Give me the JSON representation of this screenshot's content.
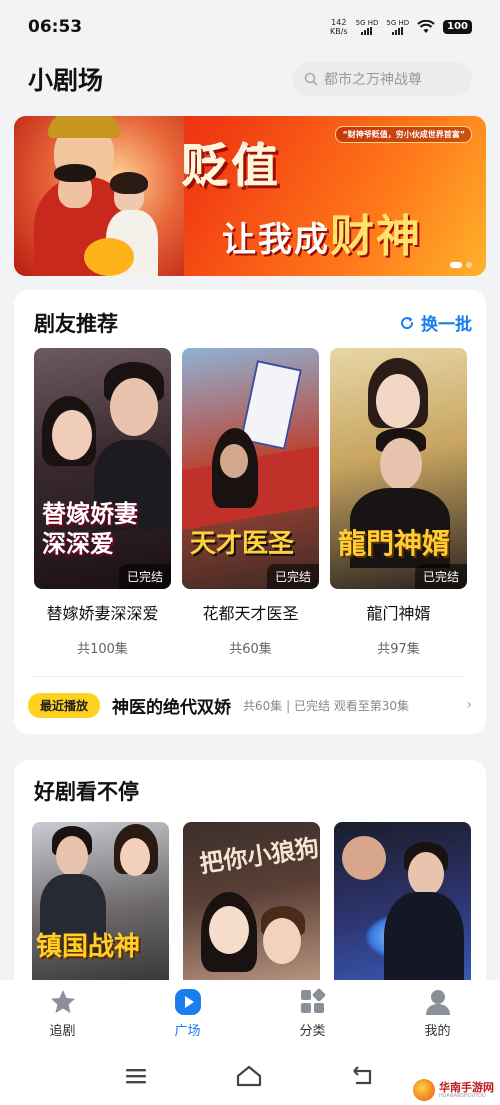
{
  "status_bar": {
    "time": "06:53",
    "net_speed_value": "142",
    "net_speed_unit": "KB/s",
    "sim1": "5G HD",
    "sim2": "5G HD",
    "battery": "100"
  },
  "header": {
    "title": "小剧场",
    "search_placeholder": "都市之万神战尊"
  },
  "banner": {
    "title_line1": "贬值",
    "title_line2_prefix": "让我成",
    "title_line2_big": "财神",
    "tagline": "“财神爷贬值，穷小伙成世界首富”",
    "accent_color": "#f23e12"
  },
  "recommend": {
    "title": "剧友推荐",
    "refresh_label": "换一批",
    "dramas": [
      {
        "name": "替嫁娇妻深深爱",
        "poster_text": "替嫁娇妻 深深爱",
        "status": "已完结",
        "episodes": "共100集"
      },
      {
        "name": "花都天才医圣",
        "poster_text": "天才医圣",
        "status": "已完结",
        "episodes": "共60集"
      },
      {
        "name": "龍门神婿",
        "poster_text": "龍門神婿",
        "status": "已完结",
        "episodes": "共97集"
      }
    ],
    "recent": {
      "badge": "最近播放",
      "title": "神医的绝代双娇",
      "info": "共60集 | 已完结 观看至第30集"
    }
  },
  "more": {
    "title": "好剧看不停",
    "posters": [
      {
        "poster_text": "镇国战神"
      },
      {
        "poster_text": "把你小狼狗"
      },
      {
        "poster_text": ""
      }
    ]
  },
  "bottom_nav": {
    "items": [
      {
        "label": "追剧",
        "icon": "star-icon"
      },
      {
        "label": "广场",
        "icon": "play-icon"
      },
      {
        "label": "分类",
        "icon": "category-icon"
      },
      {
        "label": "我的",
        "icon": "profile-icon"
      }
    ],
    "active_color": "#1a7df0"
  },
  "watermark": {
    "text": "华南手游网",
    "sub": "HUANANSHOUYOU"
  }
}
